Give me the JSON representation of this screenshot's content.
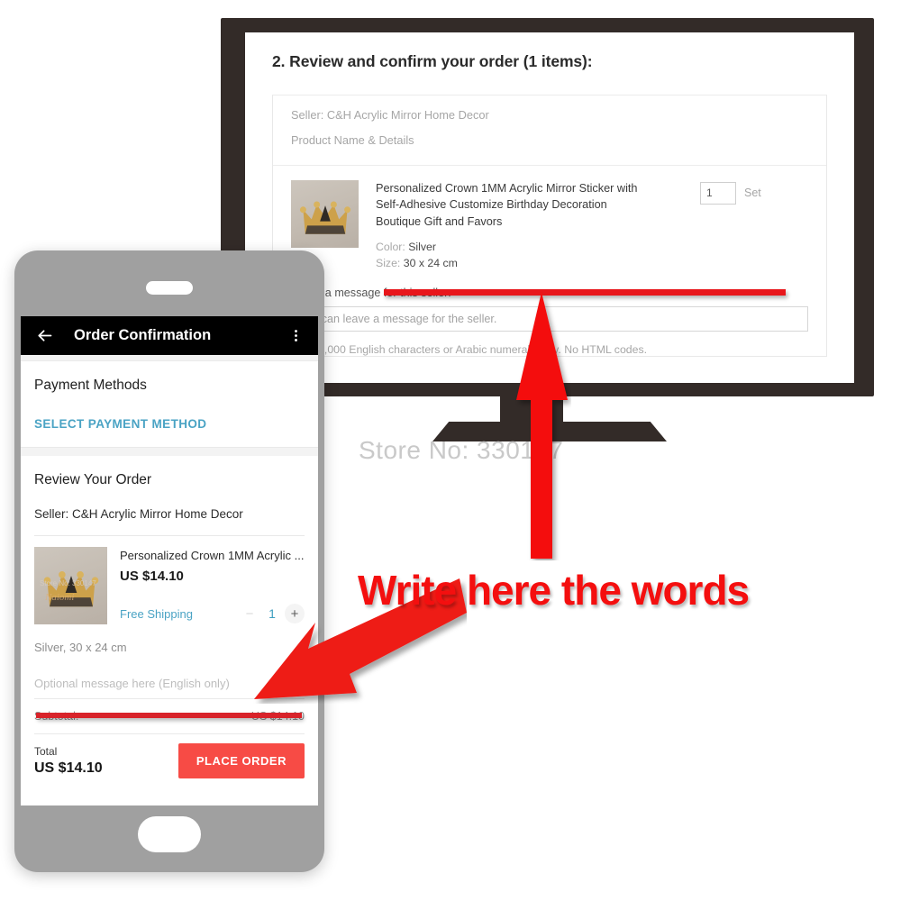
{
  "desktop": {
    "heading": "2. Review and confirm your order (1 items):",
    "seller_line": "Seller: C&H Acrylic Mirror Home Decor",
    "column_header": "Product Name & Details",
    "product": {
      "title": "Personalized Crown 1MM Acrylic Mirror Sticker with Self-Adhesive Customize Birthday Decoration Boutique Gift and Favors",
      "color_label": "Color:",
      "color_value": "Silver",
      "size_label": "Size:",
      "size_value": "30 x 24 cm",
      "quantity": "1",
      "unit": "Set"
    },
    "message": {
      "label": "Leave a message for this seller:",
      "placeholder": "You can leave a message for the seller.",
      "value": "",
      "hint": "Max. 1,000 English characters or Arabic numerals only. No HTML codes."
    }
  },
  "watermark": "Store No: 330147",
  "phone": {
    "appbar": {
      "back_icon": "arrow-left-icon",
      "title": "Order Confirmation",
      "overflow_icon": "more-vertical-icon"
    },
    "payment": {
      "heading": "Payment Methods",
      "select_link": "SELECT PAYMENT METHOD"
    },
    "review": {
      "heading": "Review Your Order",
      "seller_line": "Seller: C&H Acrylic Mirror Home Decor",
      "item_title": "Personalized Crown 1MM Acrylic ...",
      "price": "US $14.10",
      "shipping": "Free Shipping",
      "qty_minus": "−",
      "qty_value": "1",
      "qty_plus": "+",
      "variant": "Silver, 30 x 24 cm",
      "message_placeholder": "Optional message here (English only)",
      "message_value": "",
      "thumb_watermark_1": "Store No: 330147",
      "thumb_watermark_2": "Naiomi"
    },
    "totals": {
      "subtotal_label": "Subtotal:",
      "subtotal_value": "US $14.10",
      "total_label": "Total",
      "total_value": "US $14.10",
      "place_order": "PLACE ORDER"
    }
  },
  "annotation": {
    "text": "Write here the words",
    "arrow_up_name": "arrow-up-annotation",
    "arrow_diagonal_name": "arrow-down-left-annotation",
    "color": "#f40f0f",
    "underline_color": "#e8161b"
  }
}
